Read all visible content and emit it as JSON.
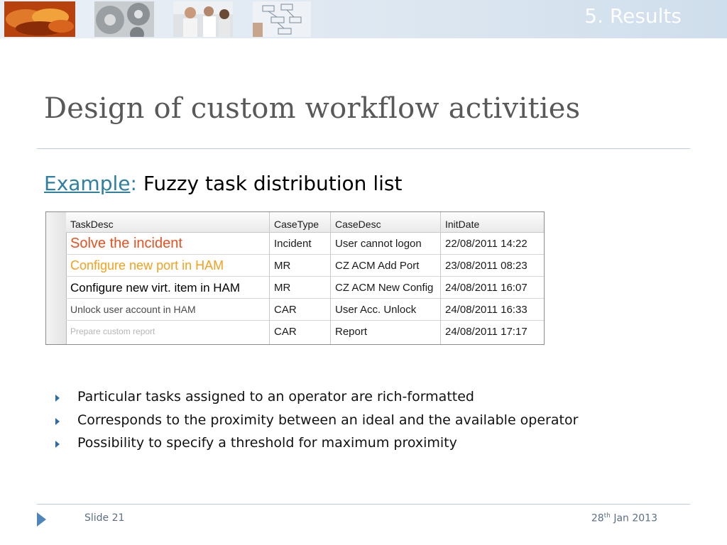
{
  "header": {
    "section": "5. Results",
    "images": [
      "hands-photo",
      "gears-photo",
      "people-photo",
      "flowchart-sketch"
    ]
  },
  "slide": {
    "title": "Design of custom workflow activities",
    "subtitle_link": "Example",
    "subtitle_colon": ":",
    "subtitle_text": "Fuzzy task distribution list"
  },
  "grid": {
    "columns": [
      "TaskDesc",
      "CaseType",
      "CaseDesc",
      "InitDate"
    ],
    "rows": [
      {
        "task": "Solve the incident",
        "type": "Incident",
        "desc": "User cannot logon",
        "date": "22/08/2011 14:22",
        "color": "#e8501f",
        "size": "20px"
      },
      {
        "task": "Configure new port in HAM",
        "type": "MR",
        "desc": "CZ ACM Add Port",
        "date": "23/08/2011 08:23",
        "color": "#f3a11f",
        "size": "18px"
      },
      {
        "task": "Configure new virt. item in HAM",
        "type": "MR",
        "desc": "CZ ACM New Config",
        "date": "24/08/2011 16:07",
        "color": "#000000",
        "size": "17px"
      },
      {
        "task": "Unlock user account in HAM",
        "type": "CAR",
        "desc": "User Acc. Unlock",
        "date": "24/08/2011 16:33",
        "color": "#4a4a4a",
        "size": "14px"
      },
      {
        "task": "Prepare custom report",
        "type": "CAR",
        "desc": "Report",
        "date": "24/08/2011 17:17",
        "color": "#b5b5b5",
        "size": "12px"
      }
    ]
  },
  "bullets": [
    "Particular tasks assigned to an operator are rich-formatted",
    "Corresponds to the proximity between an ideal and the available operator",
    "Possibility to specify a threshold for maximum proximity"
  ],
  "footer": {
    "slide_label": "Slide 21",
    "date_day": "28",
    "date_sup": "th",
    "date_rest": " Jan 2013"
  },
  "colors": {
    "accent": "#2e7fa0",
    "rule": "#b8cbe0"
  }
}
